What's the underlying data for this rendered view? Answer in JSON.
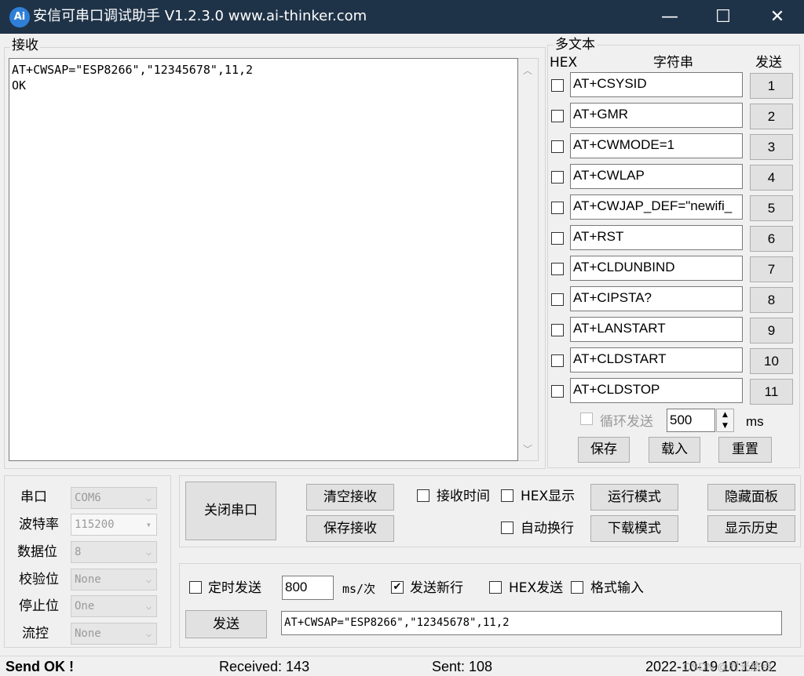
{
  "window": {
    "title": "安信可串口调试助手 V1.2.3.0    www.ai-thinker.com",
    "icon_text": "Ai",
    "controls": {
      "minimize": "—",
      "maximize": "☐",
      "close": "✕"
    }
  },
  "receive": {
    "caption": "接收",
    "lines": [
      "AT+CWSAP=\"ESP8266\",\"12345678\",11,2",
      "",
      "OK"
    ]
  },
  "multi_text": {
    "caption": "多文本",
    "headers": {
      "hex": "HEX",
      "string": "字符串",
      "send": "发送"
    },
    "rows": [
      {
        "hex": false,
        "text": "AT+CSYSID",
        "send": "1"
      },
      {
        "hex": false,
        "text": "AT+GMR",
        "send": "2"
      },
      {
        "hex": false,
        "text": "AT+CWMODE=1",
        "send": "3"
      },
      {
        "hex": false,
        "text": "AT+CWLAP",
        "send": "4"
      },
      {
        "hex": false,
        "text": "AT+CWJAP_DEF=\"newifi_",
        "send": "5"
      },
      {
        "hex": false,
        "text": "AT+RST",
        "send": "6"
      },
      {
        "hex": false,
        "text": "AT+CLDUNBIND",
        "send": "7"
      },
      {
        "hex": false,
        "text": "AT+CIPSTA?",
        "send": "8"
      },
      {
        "hex": false,
        "text": "AT+LANSTART",
        "send": "9"
      },
      {
        "hex": false,
        "text": "AT+CLDSTART",
        "send": "10"
      },
      {
        "hex": false,
        "text": "AT+CLDSTOP",
        "send": "11"
      }
    ],
    "loop_send_label": "循环发送",
    "loop_interval": "500",
    "loop_unit": "ms",
    "save_button": "保存",
    "load_button": "载入",
    "reset_button": "重置"
  },
  "serial": {
    "port_label": "串口",
    "port_value": "COM6",
    "baud_label": "波特率",
    "baud_value": "115200",
    "databits_label": "数据位",
    "databits_value": "8",
    "parity_label": "校验位",
    "parity_value": "None",
    "stopbits_label": "停止位",
    "stopbits_value": "One",
    "flow_label": "流控",
    "flow_value": "None"
  },
  "controls": {
    "close_port": "关闭串口",
    "clear_rx": "清空接收",
    "save_rx": "保存接收",
    "rx_time_label": "接收时间",
    "hex_display_label": "HEX显示",
    "auto_newline_label": "自动换行",
    "run_mode": "运行模式",
    "download_mode": "下载模式",
    "hide_panel": "隐藏面板",
    "show_history": "显示历史"
  },
  "send": {
    "timed_send_label": "定时发送",
    "interval_value": "800",
    "interval_unit": "ms/次",
    "send_newline_label": "发送新行",
    "send_newline_checked": true,
    "hex_send_label": "HEX发送",
    "format_input_label": "格式输入",
    "send_button": "发送",
    "input_value": "AT+CWSAP=\"ESP8266\",\"12345678\",11,2"
  },
  "status": {
    "message": "Send OK !",
    "received": "Received: 143",
    "sent": "Sent: 108",
    "datetime": "2022-10-19 10:14:02",
    "watermark": "CSDN @时光旅点"
  }
}
